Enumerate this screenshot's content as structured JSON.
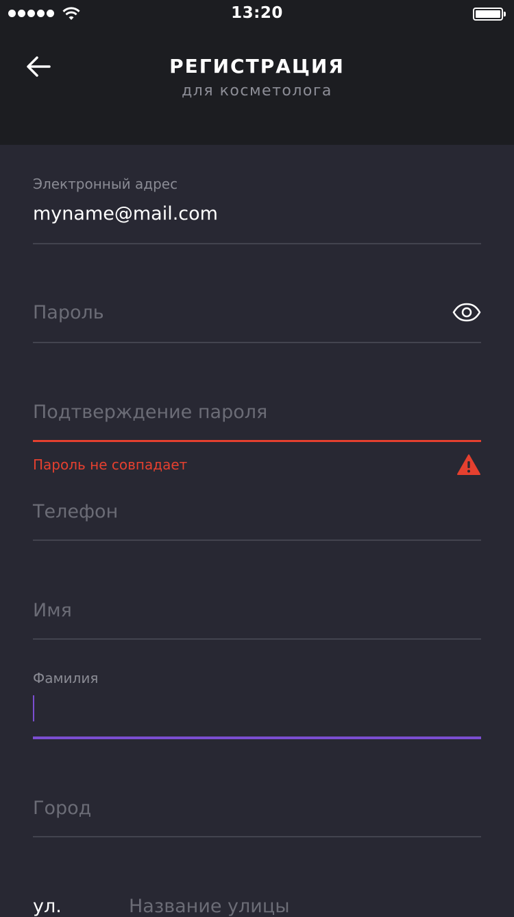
{
  "status_bar": {
    "time": "13:20",
    "signal_icon": "signal-dots-icon",
    "wifi_icon": "wifi-icon",
    "battery_icon": "battery-icon"
  },
  "header": {
    "back_icon": "arrow-left-icon",
    "title": "РЕГИСТРАЦИЯ",
    "subtitle": "для косметолога"
  },
  "form": {
    "email": {
      "label": "Электронный адрес",
      "value": "myname@mail.com"
    },
    "password": {
      "placeholder": "Пароль",
      "toggle_icon": "eye-icon"
    },
    "password_confirm": {
      "placeholder": "Подтверждение пароля",
      "error": "Пароль не совпадает",
      "error_icon": "warning-icon"
    },
    "phone": {
      "placeholder": "Телефон"
    },
    "first_name": {
      "placeholder": "Имя"
    },
    "last_name": {
      "label": "Фамилия",
      "value": ""
    },
    "city": {
      "placeholder": "Город"
    },
    "street": {
      "prefix": "ул.",
      "placeholder": "Название улицы"
    }
  },
  "colors": {
    "background": "#282833",
    "header": "#1c1d21",
    "error": "#e5402f",
    "focus": "#7b4ed1",
    "divider": "#43444f"
  }
}
